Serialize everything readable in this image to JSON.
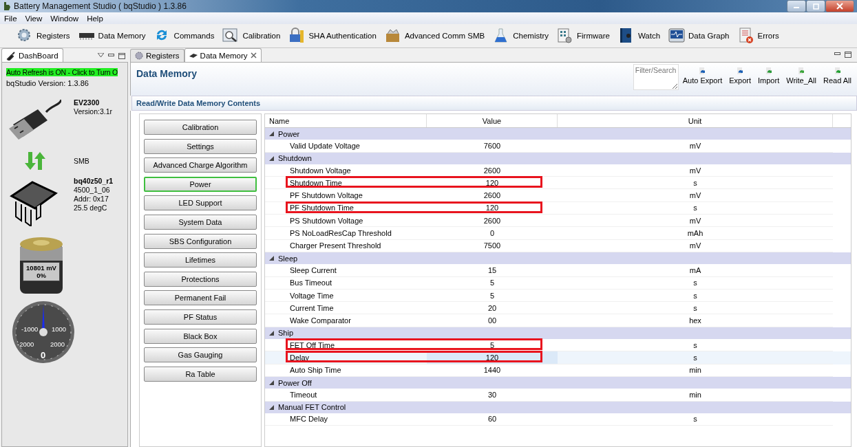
{
  "window": {
    "title": "Battery Management Studio ( bqStudio ) 1.3.86"
  },
  "menu": [
    "File",
    "View",
    "Window",
    "Help"
  ],
  "toolbar": [
    "Registers",
    "Data Memory",
    "Commands",
    "Calibration",
    "SHA Authentication",
    "Advanced Comm SMB",
    "Chemistry",
    "Firmware",
    "Watch",
    "Data Graph",
    "Errors"
  ],
  "dashboard": {
    "tab": "DashBoard",
    "auto_refresh": "Auto Refresh is ON - Click to Turn O",
    "version": "bqStudio Version:  1.3.86",
    "adapter": {
      "name": "EV2300",
      "version": "Version:3.1r"
    },
    "bus": "SMB",
    "device": {
      "name": "bq40z50_r1",
      "lines": [
        "4500_1_06",
        "Addr: 0x17",
        "25.5 degC"
      ]
    },
    "battery": {
      "voltage": "10801 mV",
      "percent": "0%"
    },
    "gauge": {
      "labels": [
        "-1000",
        "1000",
        "-2000",
        "2000"
      ],
      "reading": "0"
    }
  },
  "editor_tabs": [
    {
      "label": "Registers",
      "selected": false
    },
    {
      "label": "Data Memory",
      "selected": true
    }
  ],
  "data_memory": {
    "title": "Data Memory",
    "filter_placeholder": "Filter/Search",
    "actions": [
      "Auto Export",
      "Export",
      "Import",
      "Write_All",
      "Read All"
    ],
    "section": "Read/Write Data Memory Contents",
    "categories": [
      {
        "label": "Calibration",
        "selected": false
      },
      {
        "label": "Settings",
        "selected": false
      },
      {
        "label": "Advanced Charge Algorithm",
        "selected": false
      },
      {
        "label": "Power",
        "selected": true
      },
      {
        "label": "LED Support",
        "selected": false
      },
      {
        "label": "System Data",
        "selected": false
      },
      {
        "label": "SBS Configuration",
        "selected": false
      },
      {
        "label": "Lifetimes",
        "selected": false
      },
      {
        "label": "Protections",
        "selected": false
      },
      {
        "label": "Permanent Fail",
        "selected": false
      },
      {
        "label": "PF Status",
        "selected": false
      },
      {
        "label": "Black Box",
        "selected": false
      },
      {
        "label": "Gas Gauging",
        "selected": false
      },
      {
        "label": "Ra Table",
        "selected": false
      }
    ],
    "columns": [
      "Name",
      "Value",
      "Unit"
    ],
    "groups": [
      {
        "name": "Power",
        "expanded": true,
        "children": [
          {
            "name": "Valid Update Voltage",
            "value": "7600",
            "unit": "mV",
            "highlighted": false,
            "selected": false
          }
        ]
      },
      {
        "name": "Shutdown",
        "expanded": true,
        "children": [
          {
            "name": "Shutdown Voltage",
            "value": "2600",
            "unit": "mV",
            "highlighted": false,
            "selected": false
          },
          {
            "name": "Shutdown Time",
            "value": "120",
            "unit": "s",
            "highlighted": true,
            "selected": false
          },
          {
            "name": "PF Shutdown Voltage",
            "value": "2600",
            "unit": "mV",
            "highlighted": false,
            "selected": false
          },
          {
            "name": "PF Shutdown Time",
            "value": "120",
            "unit": "s",
            "highlighted": true,
            "selected": false
          },
          {
            "name": "PS Shutdown Voltage",
            "value": "2600",
            "unit": "mV",
            "highlighted": false,
            "selected": false
          },
          {
            "name": "PS NoLoadResCap Threshold",
            "value": "0",
            "unit": "mAh",
            "highlighted": false,
            "selected": false
          },
          {
            "name": "Charger Present Threshold",
            "value": "7500",
            "unit": "mV",
            "highlighted": false,
            "selected": false
          }
        ]
      },
      {
        "name": "Sleep",
        "expanded": true,
        "children": [
          {
            "name": "Sleep Current",
            "value": "15",
            "unit": "mA",
            "highlighted": false,
            "selected": false
          },
          {
            "name": "Bus Timeout",
            "value": "5",
            "unit": "s",
            "highlighted": false,
            "selected": false
          },
          {
            "name": "Voltage Time",
            "value": "5",
            "unit": "s",
            "highlighted": false,
            "selected": false
          },
          {
            "name": "Current Time",
            "value": "20",
            "unit": "s",
            "highlighted": false,
            "selected": false
          },
          {
            "name": "Wake Comparator",
            "value": "00",
            "unit": "hex",
            "highlighted": false,
            "selected": false
          }
        ]
      },
      {
        "name": "Ship",
        "expanded": true,
        "children": [
          {
            "name": "FET Off Time",
            "value": "5",
            "unit": "s",
            "highlighted": true,
            "selected": false
          },
          {
            "name": "Delay",
            "value": "120",
            "unit": "s",
            "highlighted": true,
            "selected": true
          },
          {
            "name": "Auto Ship Time",
            "value": "1440",
            "unit": "min",
            "highlighted": false,
            "selected": false
          }
        ]
      },
      {
        "name": "Power Off",
        "expanded": true,
        "children": [
          {
            "name": "Timeout",
            "value": "30",
            "unit": "min",
            "highlighted": false,
            "selected": false
          }
        ]
      },
      {
        "name": "Manual FET Control",
        "expanded": true,
        "children": [
          {
            "name": "MFC Delay",
            "value": "60",
            "unit": "s",
            "highlighted": false,
            "selected": false
          }
        ]
      }
    ]
  }
}
